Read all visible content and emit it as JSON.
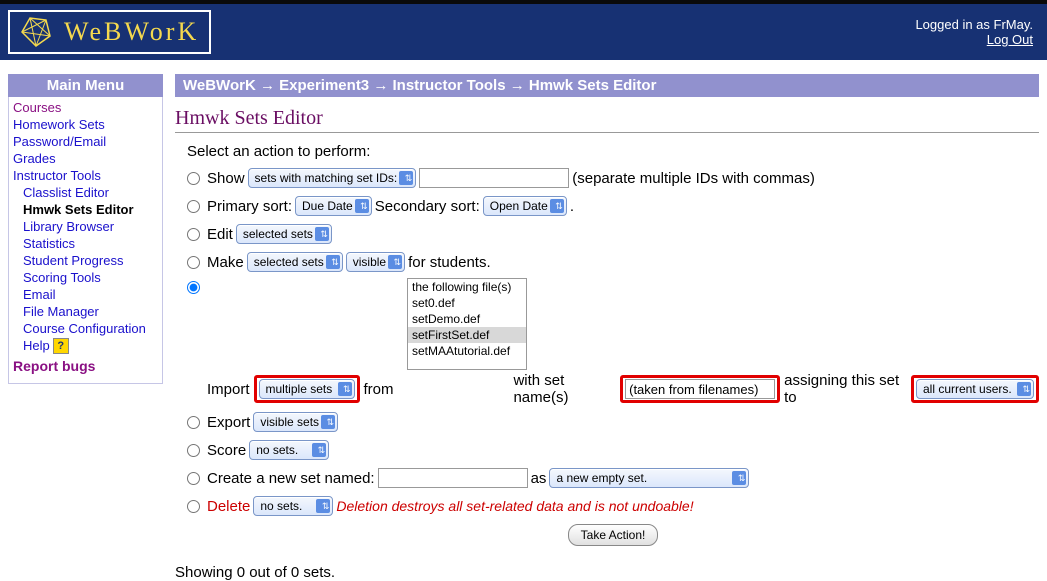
{
  "header": {
    "logo_text": "WeBWorK",
    "logged_in": "Logged in as FrMay.",
    "logout": "Log Out"
  },
  "sidebar": {
    "title": "Main Menu",
    "courses": "Courses",
    "homework_sets": "Homework Sets",
    "password_email": "Password/Email",
    "grades": "Grades",
    "instructor_tools": "Instructor Tools",
    "classlist": "Classlist Editor",
    "hmwk_sets_editor": "Hmwk Sets Editor",
    "library_browser": "Library Browser",
    "statistics": "Statistics",
    "student_progress": "Student Progress",
    "scoring_tools": "Scoring Tools",
    "email": "Email",
    "file_manager": "File Manager",
    "course_config": "Course Configuration",
    "help": "Help",
    "report_bugs": "Report bugs"
  },
  "breadcrumb": "WeBWorK → Experiment3 → Instructor Tools → Hmwk Sets Editor",
  "page_title": "Hmwk Sets Editor",
  "prompt": "Select an action to perform:",
  "actions": {
    "show": {
      "label": "Show",
      "select": "sets with matching set IDs:",
      "hint": "(separate multiple IDs with commas)"
    },
    "sort": {
      "primary_lbl": "Primary sort:",
      "primary": "Due Date",
      "secondary_lbl": "Secondary sort:",
      "secondary": "Open Date",
      "period": "."
    },
    "edit": {
      "label": "Edit",
      "select": "selected sets"
    },
    "make": {
      "label": "Make",
      "sel1": "selected sets",
      "sel2": "visible",
      "tail": "for students."
    },
    "files": [
      "the following file(s)",
      "set0.def",
      "setDemo.def",
      "setFirstSet.def",
      "setMAAtutorial.def"
    ],
    "import": {
      "label": "Import",
      "which": "multiple sets",
      "from": "from",
      "setnames_lbl": "with set name(s)",
      "setnames": "(taken from filenames)",
      "assign_lbl": "assigning this set to",
      "assign": "all current users."
    },
    "export": {
      "label": "Export",
      "select": "visible sets"
    },
    "score": {
      "label": "Score",
      "select": "no sets."
    },
    "create": {
      "label": "Create a new set named:",
      "as": "as",
      "select": "a new empty set."
    },
    "delete": {
      "label": "Delete",
      "select": "no sets.",
      "warn": "Deletion destroys all set-related data and is not undoable!"
    },
    "take_action": "Take Action!"
  },
  "footer": "Showing 0 out of 0 sets."
}
